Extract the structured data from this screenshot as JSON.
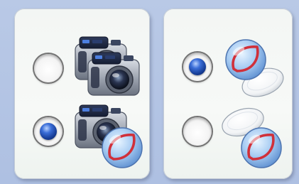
{
  "options": {
    "left_panel": [
      {
        "icon": "camera-icon",
        "selected": false
      },
      {
        "icon": "camera-with-leaf-icon",
        "selected": true
      }
    ],
    "right_panel": [
      {
        "icon": "leaf-lens-icon",
        "selected": true
      },
      {
        "icon": "blank-lens-with-leaf-icon",
        "selected": false
      }
    ]
  },
  "colors": {
    "background": "#b9c9e6",
    "panel": "#f5f8f5",
    "radio_dot": "#2a56c0",
    "leaf_stroke": "#d0303a",
    "lens": "#9ec4ef"
  }
}
